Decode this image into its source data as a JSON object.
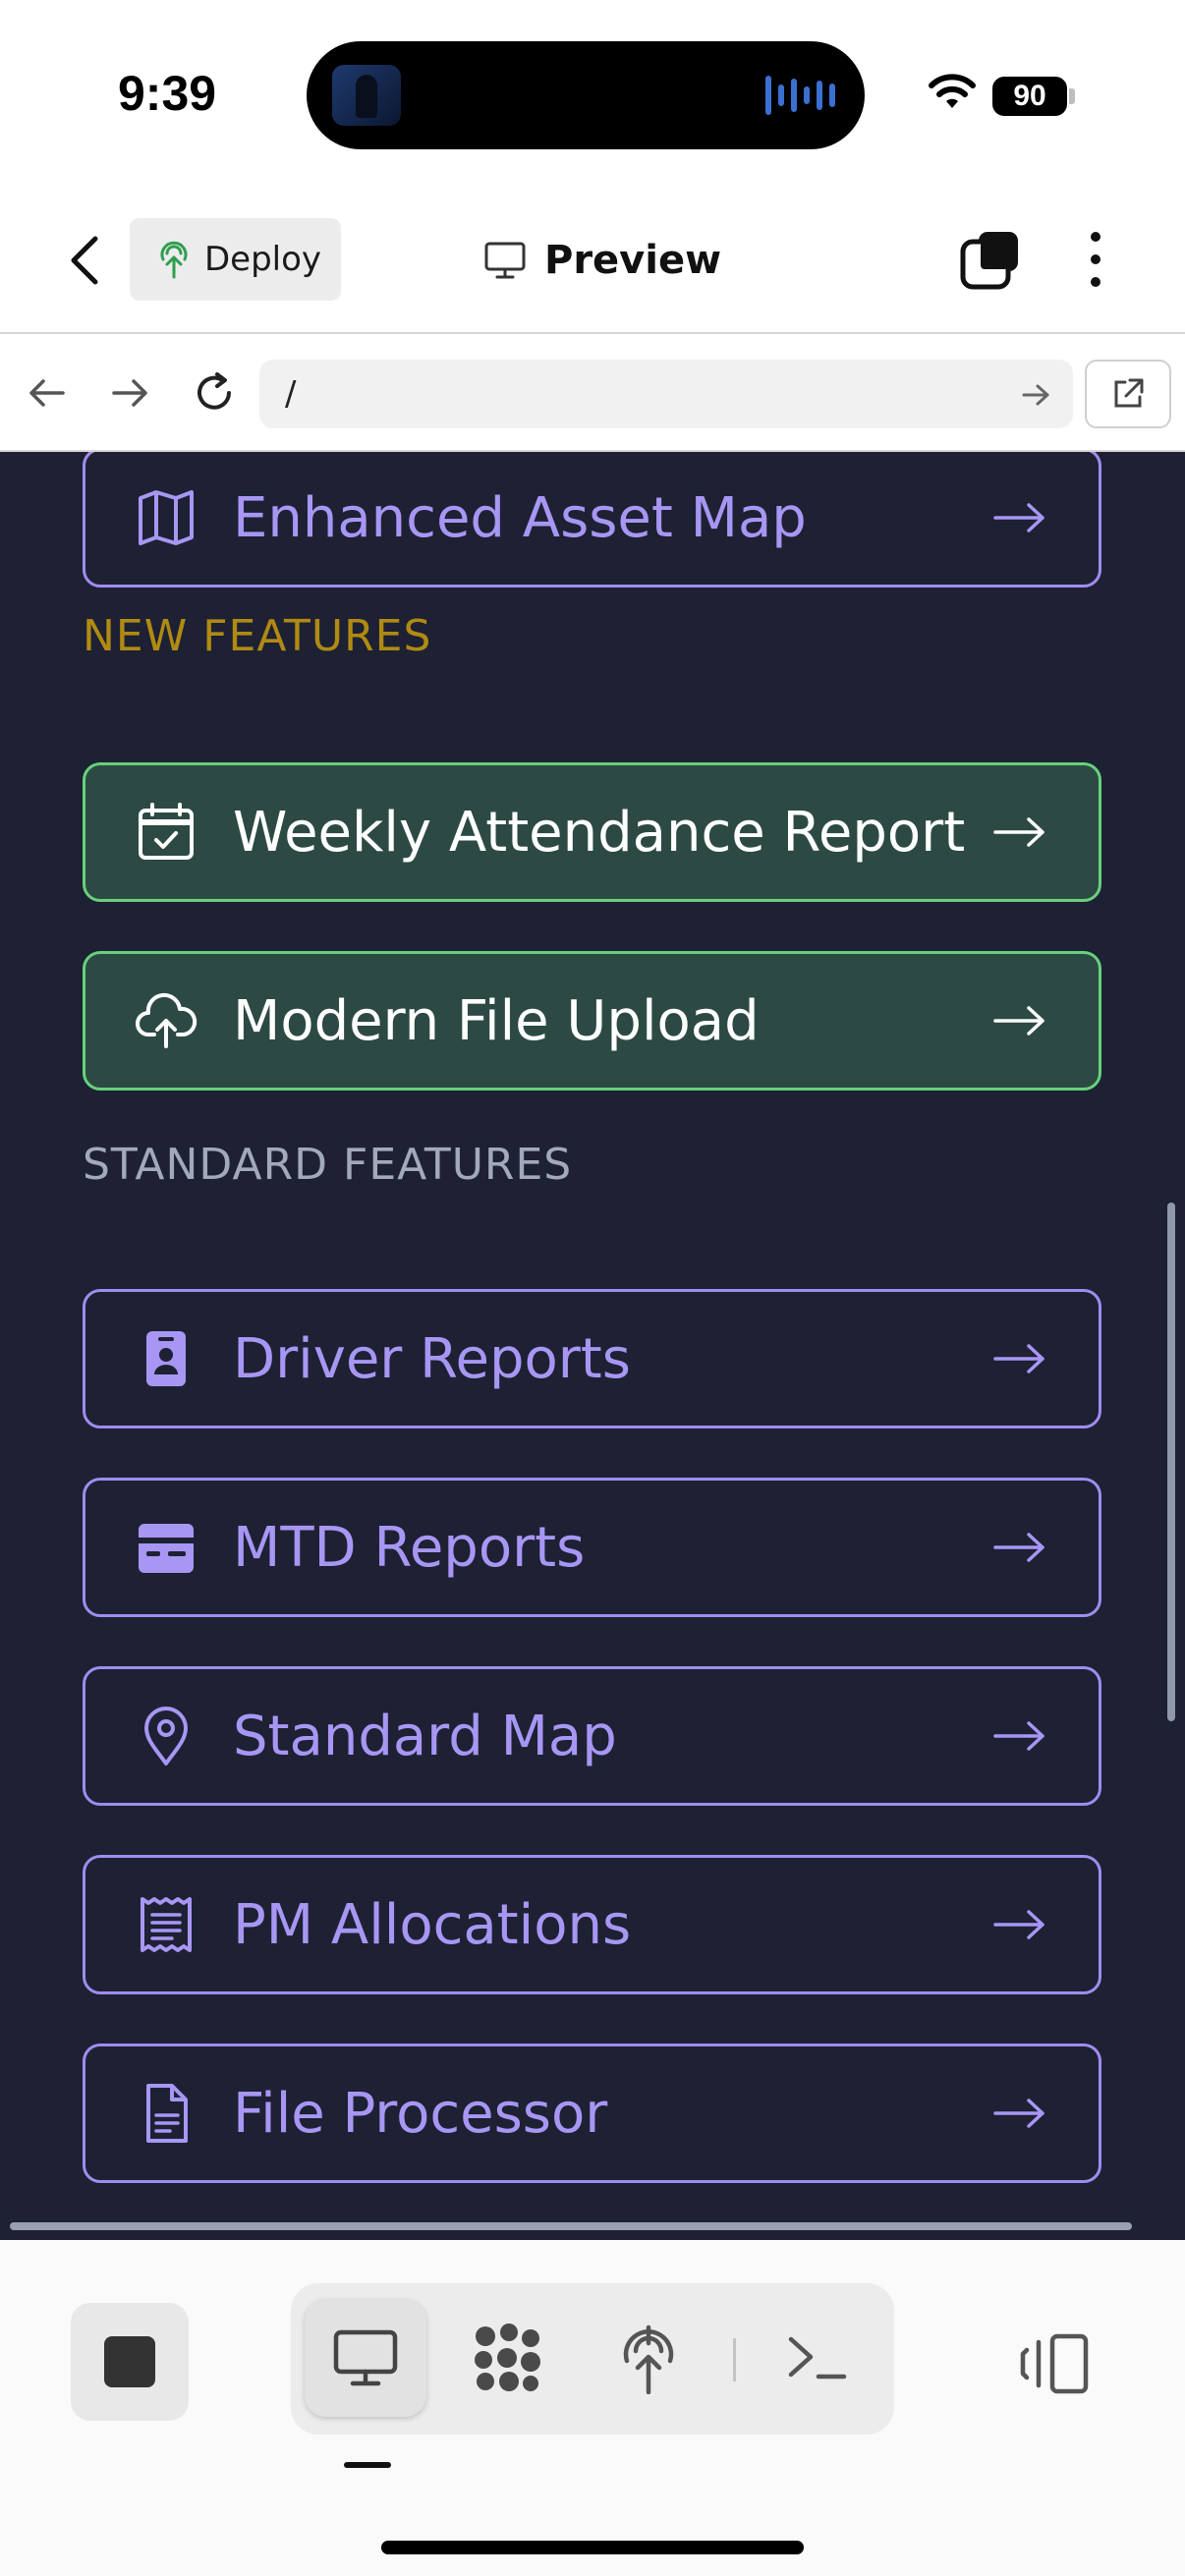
{
  "status_bar": {
    "time": "9:39",
    "battery": "90"
  },
  "header": {
    "deploy_label": "Deploy",
    "title": "Preview"
  },
  "url_bar": {
    "value": "/"
  },
  "content": {
    "top_item": {
      "label": "Enhanced Asset Map",
      "icon": "map-icon"
    },
    "new_section": {
      "label": "NEW FEATURES",
      "items": [
        {
          "label": "Weekly Attendance Report",
          "icon": "calendar-check-icon"
        },
        {
          "label": "Modern File Upload",
          "icon": "cloud-upload-icon"
        }
      ]
    },
    "standard_section": {
      "label": "STANDARD FEATURES",
      "items": [
        {
          "label": "Driver Reports",
          "icon": "id-badge-icon"
        },
        {
          "label": "MTD Reports",
          "icon": "wallet-icon"
        },
        {
          "label": "Standard Map",
          "icon": "map-pin-icon"
        },
        {
          "label": "PM Allocations",
          "icon": "receipt-icon"
        },
        {
          "label": "File Processor",
          "icon": "document-icon"
        }
      ]
    }
  },
  "colors": {
    "content_bg": "#1d2133",
    "accent_purple": "#a896f4",
    "new_feature_bg": "#2c4a43",
    "new_feature_border": "#67d07a",
    "new_section_label": "#b08a12"
  }
}
